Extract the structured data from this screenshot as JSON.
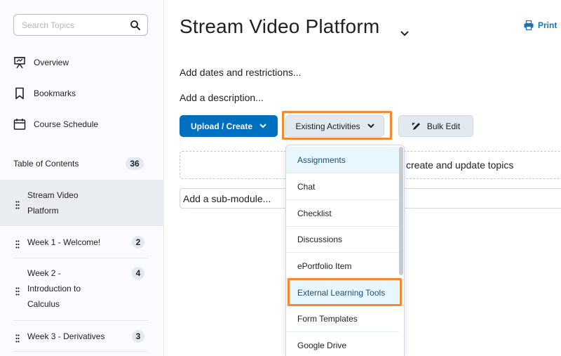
{
  "sidebar": {
    "search_placeholder": "Search Topics",
    "nav": [
      "Overview",
      "Bookmarks",
      "Course Schedule"
    ],
    "toc": {
      "label": "Table of Contents",
      "count": "36"
    },
    "modules": [
      {
        "label": "Stream Video Platform",
        "count": ""
      },
      {
        "label": "Week 1 - Welcome!",
        "count": "2"
      },
      {
        "label": "Week 2 - Introduction to Calculus",
        "count": "4"
      },
      {
        "label": "Week 3 - Derivatives",
        "count": "3"
      }
    ]
  },
  "main": {
    "title": "Stream Video Platform",
    "print_label": "Print",
    "dates_link": "Add dates and restrictions...",
    "description_link": "Add a description...",
    "buttons": {
      "upload": "Upload / Create",
      "existing": "Existing Activities",
      "bulk": "Bulk Edit"
    },
    "dropzone_text": "create and update topics",
    "submodule_placeholder": "Add a sub-module..."
  },
  "dropdown": {
    "items": [
      "Assignments",
      "Chat",
      "Checklist",
      "Discussions",
      "ePortfolio Item",
      "External Learning Tools",
      "Form Templates",
      "Google Drive"
    ]
  },
  "colors": {
    "primary": "#006fbf",
    "highlight": "#f5892f",
    "selected_bg": "#e8f6fd"
  }
}
